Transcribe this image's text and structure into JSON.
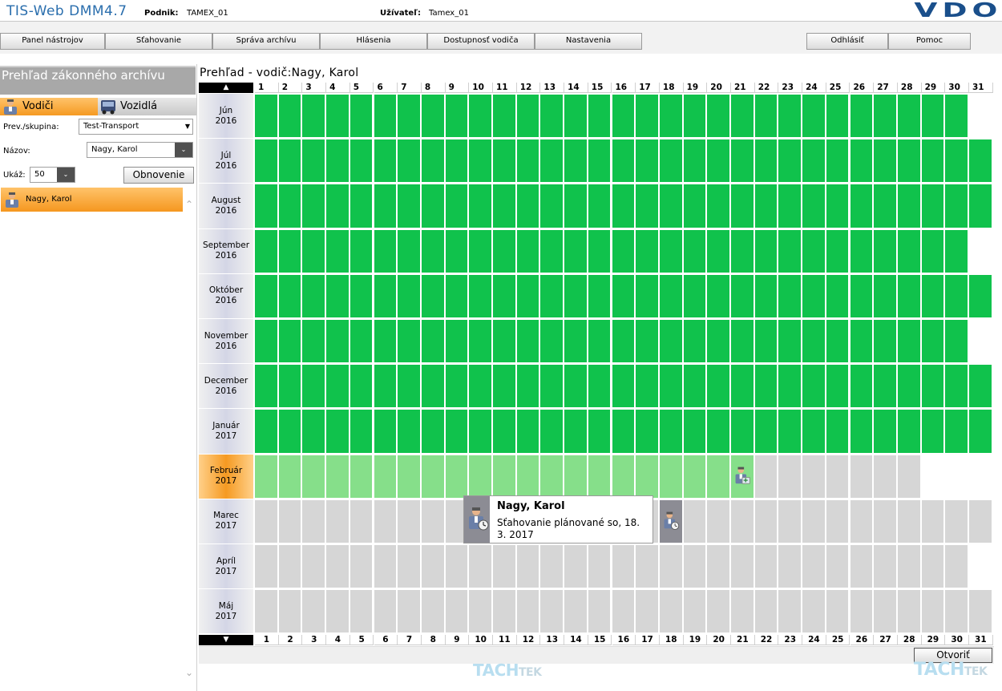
{
  "header": {
    "app_title": "TIS-Web DMM4.7",
    "company_label": "Podnik:",
    "company_value": "TAMEX_01",
    "user_label": "Užívateľ:",
    "user_value": "Tamex_01",
    "logo": "VDO"
  },
  "menu": {
    "items": [
      "Panel nástrojov",
      "Sťahovanie",
      "Správa archívu",
      "Hlásenia",
      "Dostupnosť vodiča",
      "Nastavenia"
    ],
    "logout": "Odhlásiť",
    "help": "Pomoc"
  },
  "left": {
    "title": "Prehľad zákonného archívu",
    "tab_drivers": "Vodiči",
    "tab_vehicles": "Vozidlá",
    "group_label": "Prev./skupina:",
    "group_value": "Test-Transport",
    "name_label": "Názov:",
    "name_value": "Nagy, Karol",
    "show_label": "Ukáž:",
    "show_value": "50",
    "refresh_button": "Obnovenie",
    "driver_item": "Nagy, Karol"
  },
  "calendar": {
    "title": "Prehľad - vodič:Nagy, Karol",
    "days": [
      "1",
      "2",
      "3",
      "4",
      "5",
      "6",
      "7",
      "8",
      "9",
      "10",
      "11",
      "12",
      "13",
      "14",
      "15",
      "16",
      "17",
      "18",
      "19",
      "20",
      "21",
      "22",
      "23",
      "24",
      "25",
      "26",
      "27",
      "28",
      "29",
      "30",
      "31"
    ],
    "months": [
      {
        "name": "Jún",
        "year": "2016",
        "days": 30,
        "status": "downloaded"
      },
      {
        "name": "Júl",
        "year": "2016",
        "days": 31,
        "status": "downloaded"
      },
      {
        "name": "August",
        "year": "2016",
        "days": 31,
        "status": "downloaded"
      },
      {
        "name": "September",
        "year": "2016",
        "days": 30,
        "status": "downloaded"
      },
      {
        "name": "Október",
        "year": "2016",
        "days": 31,
        "status": "downloaded"
      },
      {
        "name": "November",
        "year": "2016",
        "days": 30,
        "status": "downloaded"
      },
      {
        "name": "December",
        "year": "2016",
        "days": 31,
        "status": "downloaded"
      },
      {
        "name": "Január",
        "year": "2017",
        "days": 31,
        "status": "downloaded"
      },
      {
        "name": "Február",
        "year": "2017",
        "days": 28,
        "status": "partial",
        "last_downloaded_day": 21,
        "active": true
      },
      {
        "name": "Marec",
        "year": "2017",
        "days": 31,
        "status": "pending"
      },
      {
        "name": "Apríl",
        "year": "2017",
        "days": 30,
        "status": "pending"
      },
      {
        "name": "Máj",
        "year": "2017",
        "days": 31,
        "status": "pending"
      }
    ],
    "colors": {
      "downloaded": "#10c24c",
      "partial": "#86df8a",
      "pending": "#d6d6d6",
      "empty": "#ffffff"
    },
    "open_button": "Otvoriť"
  },
  "tooltip": {
    "name": "Nagy, Karol",
    "text": "Sťahovanie plánované so, 18. 3. 2017",
    "icon": "driver-scheduled-icon"
  },
  "watermark": {
    "tach": "TACH",
    "tek": "TEK"
  }
}
